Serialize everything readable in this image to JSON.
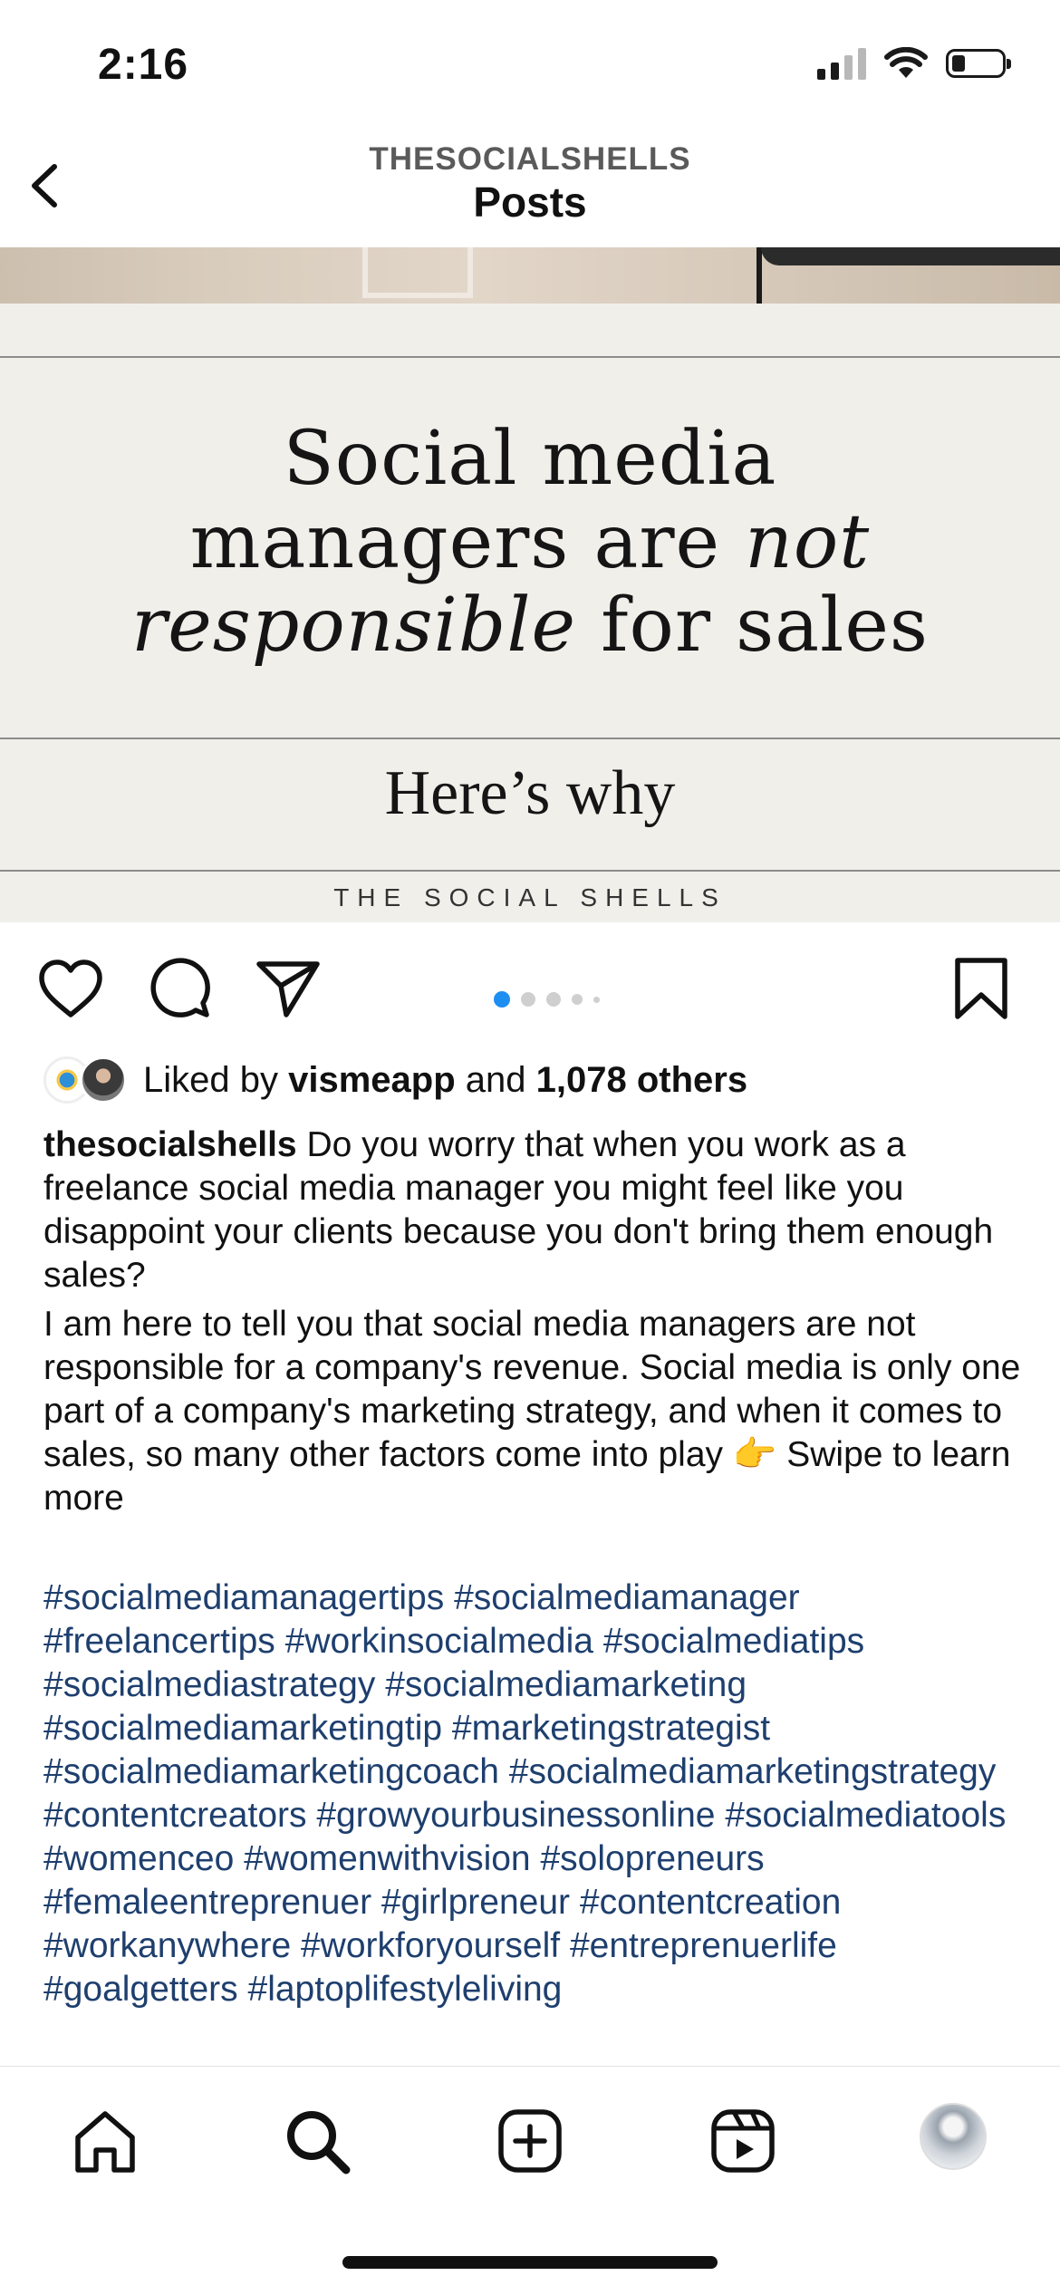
{
  "status_bar": {
    "time": "2:16"
  },
  "header": {
    "account": "THESOCIALSHELLS",
    "title": "Posts"
  },
  "post_image": {
    "headline_line1": "Social media",
    "headline_line2_a": "managers are ",
    "headline_line2_b": "not",
    "headline_line3_a": "responsible",
    "headline_line3_b": " for sales",
    "subheadline": "Here’s why",
    "brand": "THE SOCIAL SHELLS"
  },
  "carousel": {
    "total": 5,
    "active_index": 0,
    "active_color": "#1f8ef1"
  },
  "icons": {
    "back": "chevron-left-icon",
    "like": "heart-icon",
    "comment": "comment-bubble-icon",
    "share": "paper-plane-icon",
    "save": "bookmark-icon",
    "home": "home-icon",
    "search": "search-icon",
    "create": "plus-square-icon",
    "reels": "reels-icon"
  },
  "likes": {
    "prefix": "Liked by ",
    "user": "vismeapp",
    "middle": " and ",
    "count_text": "1,078 others"
  },
  "caption": {
    "username": "thesocialshells",
    "paragraph1": " Do you worry that when you work as a freelance social media manager you might feel like you disappoint your clients because you don't bring them enough sales?",
    "paragraph2": "I am here to tell you that social media managers are not responsible for a company's revenue. Social media is only one part of a company's marketing strategy, and when it comes to sales, so many other factors come into play 👉 Swipe to learn more"
  },
  "hashtags": [
    "#socialmediamanagertips",
    "#socialmediamanager",
    "#freelancertips",
    "#workinsocialmedia",
    "#socialmediatips",
    "#socialmediastrategy",
    "#socialmediamarketing",
    "#socialmediamarketingtip",
    "#marketingstrategist",
    "#socialmediamarketingcoach",
    "#socialmediamarketingstrategy",
    "#contentcreators",
    "#growyourbusinessonline",
    "#socialmediatools",
    "#womenceo",
    "#womenwithvision",
    "#solopreneurs",
    "#femaleentreprenuer",
    "#girlpreneur",
    "#contentcreation",
    "#workanywhere",
    "#workforyourself",
    "#entreprenuerlife",
    "#goalgetters",
    "#laptoplifestyleliving"
  ],
  "colors": {
    "hashtag": "#1e3f6e",
    "post_background": "#f1efea"
  }
}
